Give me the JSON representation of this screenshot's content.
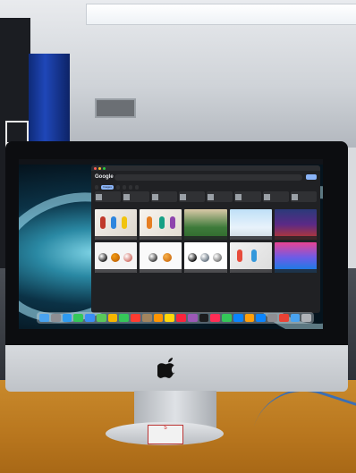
{
  "browser": {
    "engine_logo": "Google",
    "search_query": "",
    "filter_chips": [
      "",
      "Images",
      "",
      "",
      "",
      ""
    ],
    "related_searches": [
      "",
      "",
      "",
      "",
      "",
      "",
      "",
      ""
    ],
    "results_count": 10
  },
  "images": [
    {
      "caption": "",
      "kind": "people"
    },
    {
      "caption": "",
      "kind": "people"
    },
    {
      "caption": "",
      "kind": "sports-field"
    },
    {
      "caption": "",
      "kind": "sky"
    },
    {
      "caption": "",
      "kind": "team"
    },
    {
      "caption": "",
      "kind": "balls"
    },
    {
      "caption": "",
      "kind": "balls"
    },
    {
      "caption": "",
      "kind": "balls"
    },
    {
      "caption": "",
      "kind": "players"
    },
    {
      "caption": "",
      "kind": "athlete"
    }
  ],
  "dock": {
    "icon_count": 24,
    "icons": [
      "finder-icon",
      "launchpad-icon",
      "safari-icon",
      "messages-icon",
      "mail-icon",
      "maps-icon",
      "photos-icon",
      "facetime-icon",
      "calendar-icon",
      "contacts-icon",
      "reminders-icon",
      "notes-icon",
      "music-icon",
      "podcasts-icon",
      "tv-icon",
      "news-icon",
      "numbers-icon",
      "keynote-icon",
      "pages-icon",
      "appstore-icon",
      "settings-icon",
      "chrome-icon",
      "folder-icon",
      "trash-icon"
    ]
  },
  "colors": {
    "dark_bg": "#202124",
    "accent": "#8ab4f8",
    "desk": "#c98a2c"
  },
  "sticker": {
    "text": "5"
  }
}
